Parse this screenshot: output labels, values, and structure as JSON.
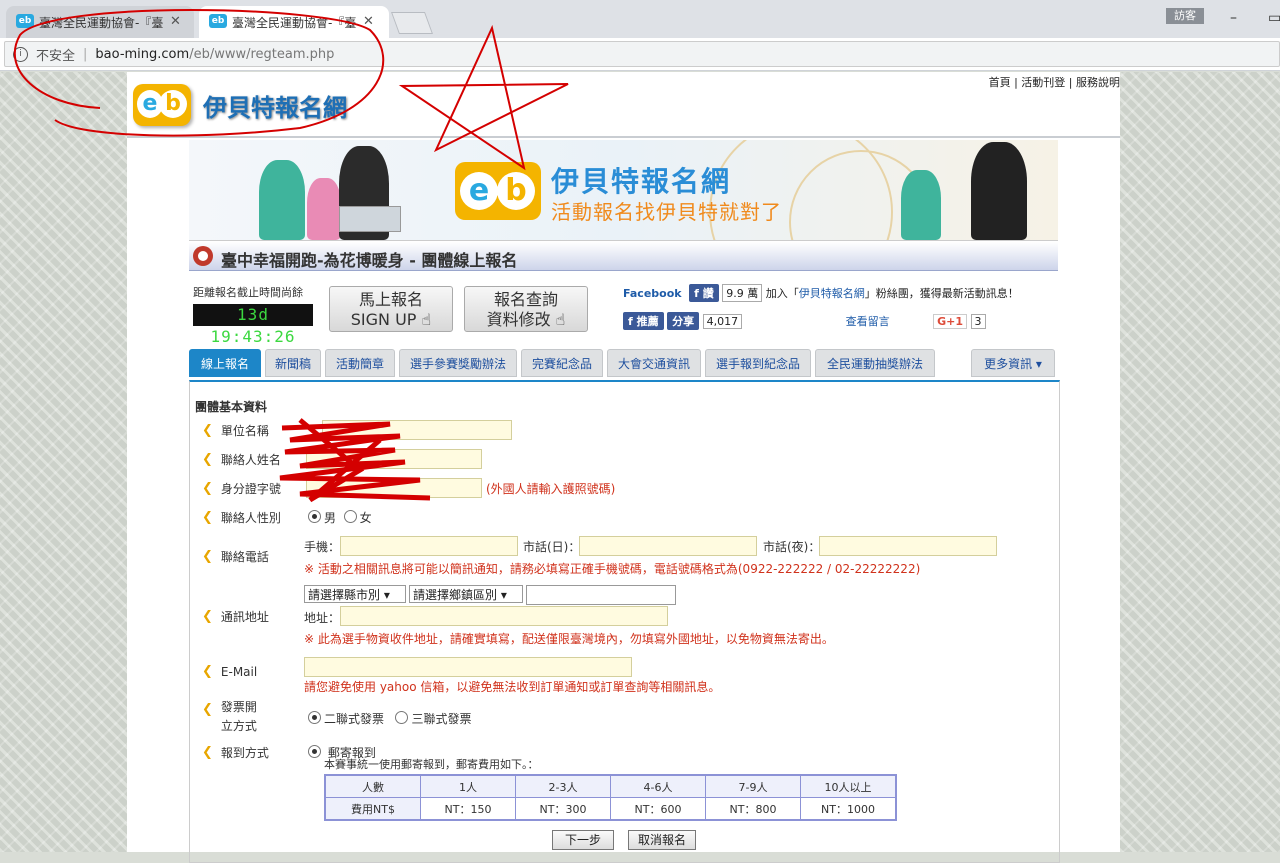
{
  "browser": {
    "tabs": [
      {
        "title": "臺灣全民運動協會-『臺"
      },
      {
        "title": "臺灣全民運動協會-『臺"
      }
    ],
    "favicon_text": "eb",
    "guest_label": "訪客",
    "minimize": "–",
    "restore": "▭",
    "url_security": "不安全",
    "url_host": "bao-ming.com",
    "url_path": "/eb/www/regteam.php"
  },
  "top_links": [
    "首頁",
    "活動刊登",
    "服務說明"
  ],
  "site": {
    "logo_e": "e",
    "logo_b": "b",
    "name": "伊貝特報名網",
    "banner_title": "伊貝特報名網",
    "banner_slogan": "活動報名找伊貝特就對了"
  },
  "page_title": "臺中幸福開跑-為花博暖身 - 團體線上報名",
  "countdown": {
    "label": "距離報名截止時間尚餘",
    "value": "13d 19:43:26"
  },
  "action_buttons": [
    {
      "line1": "馬上報名",
      "line2": "SIGN UP"
    },
    {
      "line1": "報名查詢",
      "line2": "資料修改"
    }
  ],
  "social": {
    "facebook_label": "Facebook",
    "like_label": "讚",
    "like_count": "9.9 萬",
    "join_pre": "加入「",
    "join_link": "伊貝特報名網",
    "join_post": "」粉絲團，獲得最新活動訊息！",
    "recommend_label": "推薦",
    "share_label": "分享",
    "share_count": "4,017",
    "comments_link": "查看留言",
    "gplus_label": "G+1",
    "gplus_count": "3"
  },
  "nav_tabs": [
    "線上報名",
    "新聞稿",
    "活動簡章",
    "選手參賽獎勵辦法",
    "完賽紀念品",
    "大會交通資訊",
    "選手報到紀念品",
    "全民運動抽獎辦法",
    "更多資訊 ▾"
  ],
  "form": {
    "section_title": "團體基本資料",
    "fields": {
      "org_name": "單位名稱",
      "contact_name": "聯絡人姓名",
      "id_number": "身分證字號",
      "id_note": "(外國人請輸入護照號碼)",
      "gender": "聯絡人性別",
      "gender_male": "男",
      "gender_female": "女",
      "phone": "聯絡電話",
      "mobile": "手機：",
      "tel_day": "市話(日)：",
      "tel_night": "市話(夜)：",
      "phone_note": "※ 活動之相關訊息將可能以簡訊通知，請務必填寫正確手機號碼，電話號碼格式為(0922-222222 / 02-22222222)",
      "address": "通訊地址",
      "city_select": "請選擇縣市別 ▾",
      "district_select": "請選擇鄉鎮區別 ▾",
      "address_label": "地址：",
      "address_note": "※ 此為選手物資收件地址，請確實填寫，配送僅限臺灣境內，勿填寫外國地址，以免物資無法寄出。",
      "email": "E-Mail",
      "email_note": "請您避免使用 yahoo 信箱，以避免無法收到訂單通知或訂單查詢等相關訊息。",
      "invoice_line1": "發票開",
      "invoice_line2": "立方式",
      "invoice_opt1": "二聯式發票",
      "invoice_opt2": "三聯式發票",
      "checkin": "報到方式",
      "checkin_opt": "郵寄報到",
      "checkin_note": "本賽事統一使用郵寄報到，郵寄費用如下。："
    },
    "fee_table": {
      "headers": [
        "人數",
        "1人",
        "2-3人",
        "4-6人",
        "7-9人",
        "10人以上"
      ],
      "row": [
        "費用NT$",
        "NT：150",
        "NT：300",
        "NT：600",
        "NT：800",
        "NT：1000"
      ]
    },
    "next_button": "下一步",
    "cancel_button": "取消報名"
  }
}
